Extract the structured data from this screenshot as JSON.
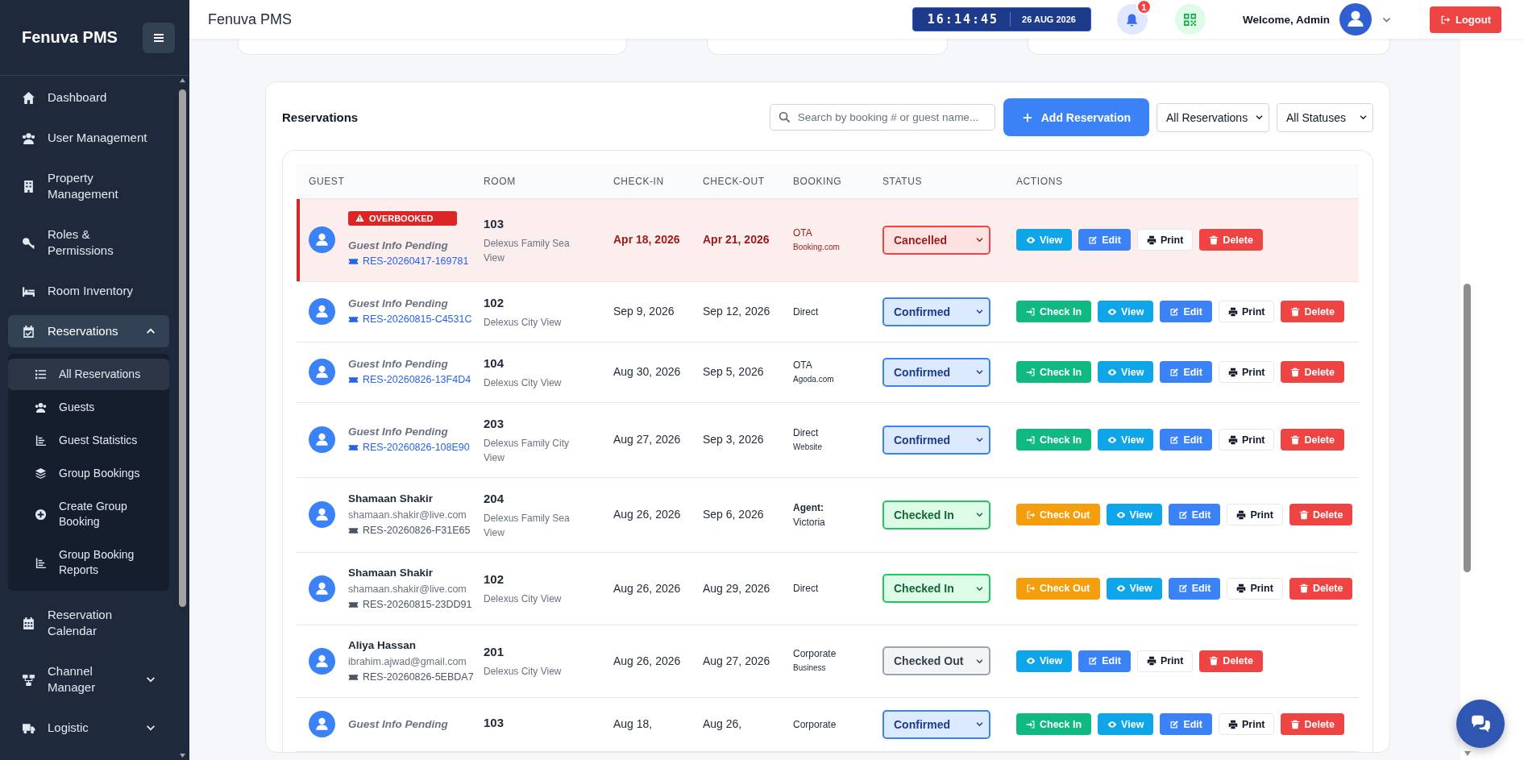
{
  "sidebar": {
    "brand": "Fenuva PMS",
    "items": [
      {
        "label": "Dashboard",
        "selected": false
      },
      {
        "label": "User Management",
        "selected": false
      },
      {
        "label": "Property Management",
        "selected": false
      },
      {
        "label": "Roles & Permissions",
        "selected": false
      },
      {
        "label": "Room Inventory",
        "selected": false
      },
      {
        "label": "Reservations",
        "selected": true,
        "expanded": true,
        "children": [
          {
            "label": "All Reservations",
            "selected": true
          },
          {
            "label": "Guests",
            "selected": false
          },
          {
            "label": "Guest Statistics",
            "selected": false
          },
          {
            "label": "Group Bookings",
            "selected": false
          },
          {
            "label": "Create Group Booking",
            "selected": false
          },
          {
            "label": "Group Booking Reports",
            "selected": false
          }
        ]
      },
      {
        "label": "Reservation Calendar",
        "selected": false
      },
      {
        "label": "Channel Manager",
        "selected": false,
        "expanded": false
      },
      {
        "label": "Logistic",
        "selected": false,
        "expanded": false
      }
    ]
  },
  "topbar": {
    "title": "Fenuva PMS",
    "clock": {
      "time": "16:14:45",
      "date": "26 AUG 2026"
    },
    "notifications": {
      "count": "1"
    },
    "welcome": "Welcome, Admin",
    "logout": "Logout"
  },
  "reservations": {
    "title": "Reservations",
    "search": {
      "placeholder": "Search by booking # or guest name..."
    },
    "add_button": "Add Reservation",
    "filters": [
      {
        "value": "All Reservations"
      },
      {
        "value": "All Statuses"
      }
    ],
    "table": {
      "columns": [
        "GUEST",
        "ROOM",
        "CHECK-IN",
        "CHECK-OUT",
        "BOOKING",
        "STATUS",
        "ACTIONS"
      ],
      "rows": [
        {
          "overbooked": true,
          "badge": "OVERBOOKED",
          "guest": {
            "kind": "pending",
            "name": "Guest Info Pending",
            "reservation_no": "RES-20260417-169781"
          },
          "room": {
            "number": "103",
            "type": "Delexus Family Sea View"
          },
          "check_in": "Apr 18, 2026",
          "check_out": "Apr 21, 2026",
          "booking": {
            "kind": "source",
            "source": "OTA",
            "detail": "Booking.com"
          },
          "status": {
            "kind": "cancelled",
            "label": "Cancelled"
          },
          "actions": [
            {
              "kind": "view",
              "label": "View"
            },
            {
              "kind": "edit",
              "label": "Edit"
            },
            {
              "kind": "print",
              "label": "Print"
            },
            {
              "kind": "delete",
              "label": "Delete"
            }
          ]
        },
        {
          "overbooked": false,
          "guest": {
            "kind": "pending",
            "name": "Guest Info Pending",
            "reservation_no": "RES-20260815-C4531C"
          },
          "room": {
            "number": "102",
            "type": "Delexus City View"
          },
          "check_in": "Sep 9, 2026",
          "check_out": "Sep 12, 2026",
          "booking": {
            "kind": "source",
            "source": "Direct"
          },
          "status": {
            "kind": "confirmed",
            "label": "Confirmed"
          },
          "actions": [
            {
              "kind": "check_in",
              "label": "Check In"
            },
            {
              "kind": "view",
              "label": "View"
            },
            {
              "kind": "edit",
              "label": "Edit"
            },
            {
              "kind": "print",
              "label": "Print"
            },
            {
              "kind": "delete",
              "label": "Delete"
            }
          ]
        },
        {
          "overbooked": false,
          "guest": {
            "kind": "pending",
            "name": "Guest Info Pending",
            "reservation_no": "RES-20260826-13F4D4"
          },
          "room": {
            "number": "104",
            "type": "Delexus City View"
          },
          "check_in": "Aug 30, 2026",
          "check_out": "Sep 5, 2026",
          "booking": {
            "kind": "source",
            "source": "OTA",
            "detail": "Agoda.com"
          },
          "status": {
            "kind": "confirmed",
            "label": "Confirmed"
          },
          "actions": [
            {
              "kind": "check_in",
              "label": "Check In"
            },
            {
              "kind": "view",
              "label": "View"
            },
            {
              "kind": "edit",
              "label": "Edit"
            },
            {
              "kind": "print",
              "label": "Print"
            },
            {
              "kind": "delete",
              "label": "Delete"
            }
          ]
        },
        {
          "overbooked": false,
          "guest": {
            "kind": "pending",
            "name": "Guest Info Pending",
            "reservation_no": "RES-20260826-108E90"
          },
          "room": {
            "number": "203",
            "type": "Delexus Family City View"
          },
          "check_in": "Aug 27, 2026",
          "check_out": "Sep 3, 2026",
          "booking": {
            "kind": "source",
            "source": "Direct",
            "detail": "Website"
          },
          "status": {
            "kind": "confirmed",
            "label": "Confirmed"
          },
          "actions": [
            {
              "kind": "check_in",
              "label": "Check In"
            },
            {
              "kind": "view",
              "label": "View"
            },
            {
              "kind": "edit",
              "label": "Edit"
            },
            {
              "kind": "print",
              "label": "Print"
            },
            {
              "kind": "delete",
              "label": "Delete"
            }
          ]
        },
        {
          "overbooked": false,
          "guest": {
            "kind": "named",
            "name": "Shamaan Shakir",
            "email": "shamaan.shakir@live.com",
            "reservation_no": "RES-20260826-F31E65"
          },
          "room": {
            "number": "204",
            "type": "Delexus Family Sea View"
          },
          "check_in": "Aug 26, 2026",
          "check_out": "Sep 6, 2026",
          "booking": {
            "kind": "agent",
            "source": "Agent:",
            "detail": "Victoria"
          },
          "status": {
            "kind": "checked_in",
            "label": "Checked In"
          },
          "actions": [
            {
              "kind": "check_out",
              "label": "Check Out"
            },
            {
              "kind": "view",
              "label": "View"
            },
            {
              "kind": "edit",
              "label": "Edit"
            },
            {
              "kind": "print",
              "label": "Print"
            },
            {
              "kind": "delete",
              "label": "Delete"
            }
          ]
        },
        {
          "overbooked": false,
          "guest": {
            "kind": "named",
            "name": "Shamaan Shakir",
            "email": "shamaan.shakir@live.com",
            "reservation_no": "RES-20260815-23DD91"
          },
          "room": {
            "number": "102",
            "type": "Delexus City View"
          },
          "check_in": "Aug 26, 2026",
          "check_out": "Aug 29, 2026",
          "booking": {
            "kind": "source",
            "source": "Direct"
          },
          "status": {
            "kind": "checked_in",
            "label": "Checked In"
          },
          "actions": [
            {
              "kind": "check_out",
              "label": "Check Out"
            },
            {
              "kind": "view",
              "label": "View"
            },
            {
              "kind": "edit",
              "label": "Edit"
            },
            {
              "kind": "print",
              "label": "Print"
            },
            {
              "kind": "delete",
              "label": "Delete"
            }
          ]
        },
        {
          "overbooked": false,
          "guest": {
            "kind": "named",
            "name": "Aliya Hassan",
            "email": "ibrahim.ajwad@gmail.com",
            "reservation_no": "RES-20260826-5EBDA7"
          },
          "room": {
            "number": "201",
            "type": "Delexus City View"
          },
          "check_in": "Aug 26, 2026",
          "check_out": "Aug 27, 2026",
          "booking": {
            "kind": "source",
            "source": "Corporate",
            "detail": "Business"
          },
          "status": {
            "kind": "checked_out",
            "label": "Checked Out"
          },
          "actions": [
            {
              "kind": "view",
              "label": "View"
            },
            {
              "kind": "edit",
              "label": "Edit"
            },
            {
              "kind": "print",
              "label": "Print"
            },
            {
              "kind": "delete",
              "label": "Delete"
            }
          ]
        },
        {
          "overbooked": false,
          "guest": {
            "kind": "pending",
            "name": "Guest Info Pending"
          },
          "room": {
            "number": "103"
          },
          "check_in": "Aug 18,",
          "check_out": "Aug 26,",
          "booking": {
            "kind": "source",
            "source": "Corporate"
          },
          "status": {
            "kind": "confirmed",
            "label": "Confirmed"
          },
          "actions": [
            {
              "kind": "check_in",
              "label": "Check In"
            },
            {
              "kind": "view",
              "label": "View"
            },
            {
              "kind": "edit",
              "label": "Edit"
            },
            {
              "kind": "print",
              "label": "Print"
            },
            {
              "kind": "delete",
              "label": "Delete"
            }
          ]
        }
      ]
    }
  }
}
